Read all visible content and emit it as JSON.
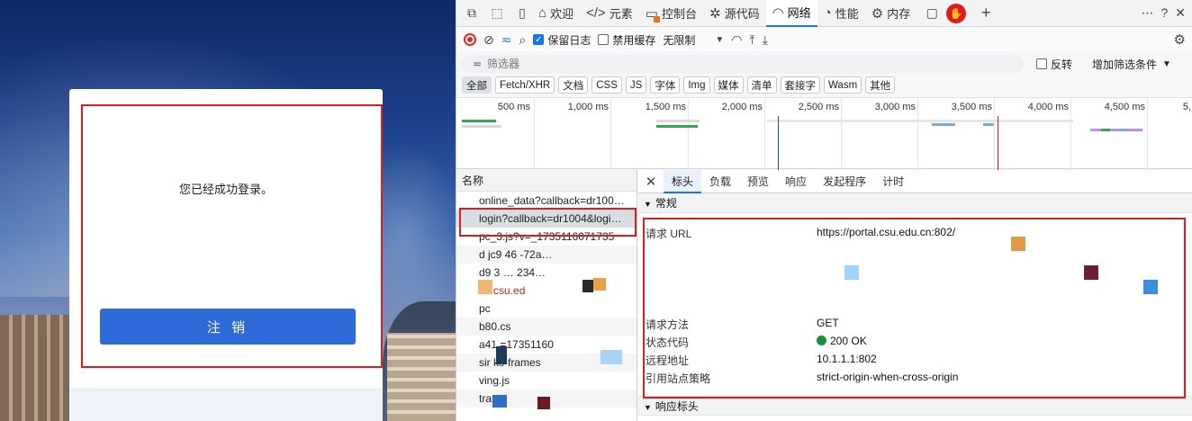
{
  "webpage": {
    "message": "您已经成功登录。",
    "logout_label": "注 销"
  },
  "devtools": {
    "tabs": [
      "欢迎",
      "元素",
      "控制台",
      "源代码",
      "网络",
      "性能",
      "内存"
    ],
    "toolbar": {
      "preserve_log": "保留日志",
      "disable_cache": "禁用缓存",
      "throttle": "无限制"
    },
    "filter": {
      "placeholder": "筛选器",
      "invert": "反转",
      "more_filters": "增加筛选条件"
    },
    "types": [
      "全部",
      "Fetch/XHR",
      "文档",
      "CSS",
      "JS",
      "字体",
      "Img",
      "媒体",
      "清单",
      "套接字",
      "Wasm",
      "其他"
    ],
    "timeline": [
      "500 ms",
      "1,000 ms",
      "1,500 ms",
      "2,000 ms",
      "2,500 ms",
      "3,000 ms",
      "3,500 ms",
      "4,000 ms",
      "4,500 ms",
      "5,"
    ],
    "list": {
      "header": "名称",
      "rows": [
        "online_data?callback=dr100…",
        "login?callback=dr1004&logi…",
        "pc_3.js?v=_1735116071735",
        "d      jc9     46           -72a…",
        "d9      3     …            234…",
        "tal.csu.ed",
        "pc              ",
        "b80.cs",
        "a41              =17351160",
        "sir              ks-frames",
        "ving.js",
        "trans             "
      ]
    },
    "detail": {
      "tabs": [
        "标头",
        "负载",
        "预览",
        "响应",
        "发起程序",
        "计时"
      ],
      "general_title": "常规",
      "response_headers_title": "响应标头",
      "request_url_label": "请求 URL",
      "request_url_value": "https://portal.csu.edu.cn:802/",
      "method_label": "请求方法",
      "method_value": "GET",
      "status_label": "状态代码",
      "status_value": "200 OK",
      "remote_label": "远程地址",
      "remote_value": "10.1.1.1:802",
      "referrer_label": "引用站点策略",
      "referrer_value": "strict-origin-when-cross-origin"
    }
  }
}
